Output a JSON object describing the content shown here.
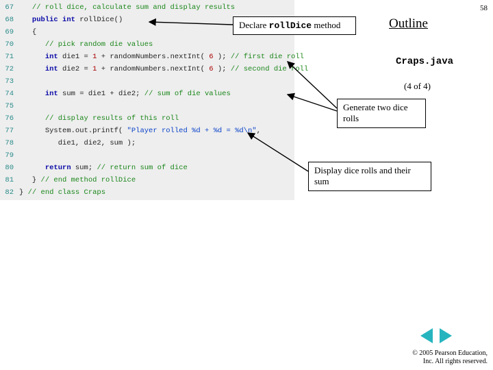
{
  "page_number": "58",
  "outline_heading": "Outline",
  "file_name": "Craps.java",
  "part_label": "(4 of 4)",
  "callouts": {
    "c1": {
      "prefix": "Declare ",
      "mono": "rollDice",
      "suffix": " method"
    },
    "c2": "Generate two dice rolls",
    "c3": "Display dice rolls and their sum"
  },
  "code": {
    "l67": {
      "n": "67",
      "cm": "// roll dice, calculate sum and display results"
    },
    "l68": {
      "n": "68",
      "kw1": "public",
      "kw2": "int",
      "name": "rollDice()"
    },
    "l69": {
      "n": "69",
      "brace": "{"
    },
    "l70": {
      "n": "70",
      "cm": "// pick random die values"
    },
    "l71": {
      "n": "71",
      "kw": "int",
      "var": "die1 = ",
      "lit1": "1",
      "plus": " + randomNumbers.nextInt( ",
      "lit2": "6",
      "close": " ); ",
      "cm": "// first die roll"
    },
    "l72": {
      "n": "72",
      "kw": "int",
      "var": "die2 = ",
      "lit1": "1",
      "plus": " + randomNumbers.nextInt( ",
      "lit2": "6",
      "close": " ); ",
      "cm": "// second die roll"
    },
    "l73": {
      "n": "73"
    },
    "l74": {
      "n": "74",
      "kw": "int",
      "expr": "sum = die1 + die2; ",
      "cm": "// sum of die values"
    },
    "l75": {
      "n": "75"
    },
    "l76": {
      "n": "76",
      "cm": "// display results of this roll"
    },
    "l77": {
      "n": "77",
      "call": "System.out.printf( ",
      "str": "\"Player rolled %d + %d = %d\\n\"",
      "comma": ","
    },
    "l78": {
      "n": "78",
      "args": "die1, die2, sum );"
    },
    "l79": {
      "n": "79"
    },
    "l80": {
      "n": "80",
      "kw": "return",
      "expr": " sum; ",
      "cm": "// return sum of dice"
    },
    "l81": {
      "n": "81",
      "brace": "} ",
      "cm": "// end method rollDice"
    },
    "l82": {
      "n": "82",
      "brace": "} ",
      "cm": "// end class Craps"
    }
  },
  "footer": {
    "line1": "© 2005 Pearson Education,",
    "line2": "Inc.  All rights reserved."
  }
}
